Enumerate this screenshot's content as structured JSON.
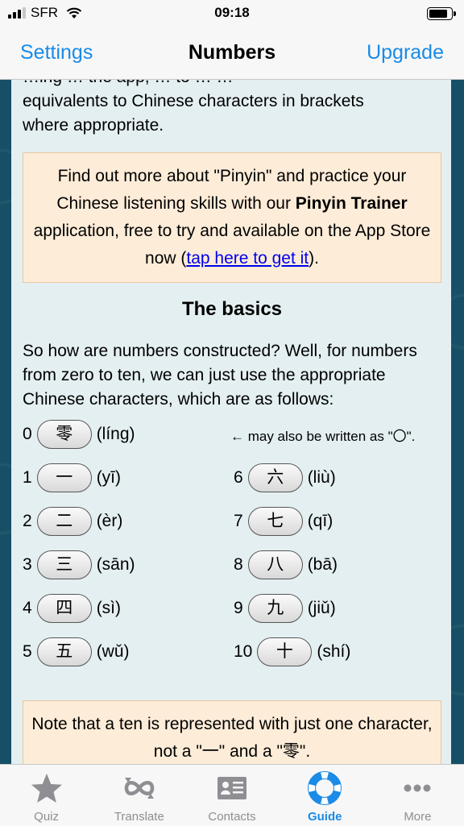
{
  "status": {
    "carrier": "SFR",
    "time": "09:18"
  },
  "nav": {
    "left": "Settings",
    "title": "Numbers",
    "right": "Upgrade"
  },
  "intro": {
    "line1": "…ing … the app, … to … …",
    "line2": "equivalents to Chinese characters in brackets",
    "line3": "where appropriate."
  },
  "callout1": {
    "text_before": "Find out more about \"Pinyin\" and practice your Chinese listening skills with our ",
    "bold": "Pinyin Trainer",
    "text_middle": " application, free to try and available on the App Store now (",
    "link": "tap here to get it",
    "text_after": ")."
  },
  "heading": "The basics",
  "para": "So how are numbers constructed? Well, for numbers from zero to ten, we can just use the appropriate Chinese characters, which are as follows:",
  "numbers": [
    {
      "n": "0",
      "char": "零",
      "pinyin": "(líng)"
    },
    {
      "n": "1",
      "char": "一",
      "pinyin": "(yī)"
    },
    {
      "n": "2",
      "char": "二",
      "pinyin": "(èr)"
    },
    {
      "n": "3",
      "char": "三",
      "pinyin": "(sān)"
    },
    {
      "n": "4",
      "char": "四",
      "pinyin": "(sì)"
    },
    {
      "n": "5",
      "char": "五",
      "pinyin": "(wǔ)"
    },
    {
      "n": "6",
      "char": "六",
      "pinyin": "(liù)"
    },
    {
      "n": "7",
      "char": "七",
      "pinyin": "(qī)"
    },
    {
      "n": "8",
      "char": "八",
      "pinyin": "(bā)"
    },
    {
      "n": "9",
      "char": "九",
      "pinyin": "(jiǔ)"
    },
    {
      "n": "10",
      "char": "十",
      "pinyin": "(shí)"
    }
  ],
  "zero_note": "← may also be written as \"〇\".",
  "callout2": "Note that a ten is represented with just one character, not a \"一\" and a \"零\".",
  "tabs": [
    {
      "label": "Quiz",
      "icon": "star-icon"
    },
    {
      "label": "Translate",
      "icon": "translate-icon"
    },
    {
      "label": "Contacts",
      "icon": "contacts-icon"
    },
    {
      "label": "Guide",
      "icon": "lifebuoy-icon",
      "active": true
    },
    {
      "label": "More",
      "icon": "more-icon"
    }
  ],
  "colors": {
    "accent": "#1a8be6",
    "callout_bg": "#fdecd8",
    "card_bg": "#e4eff2",
    "background": "#164f66"
  }
}
